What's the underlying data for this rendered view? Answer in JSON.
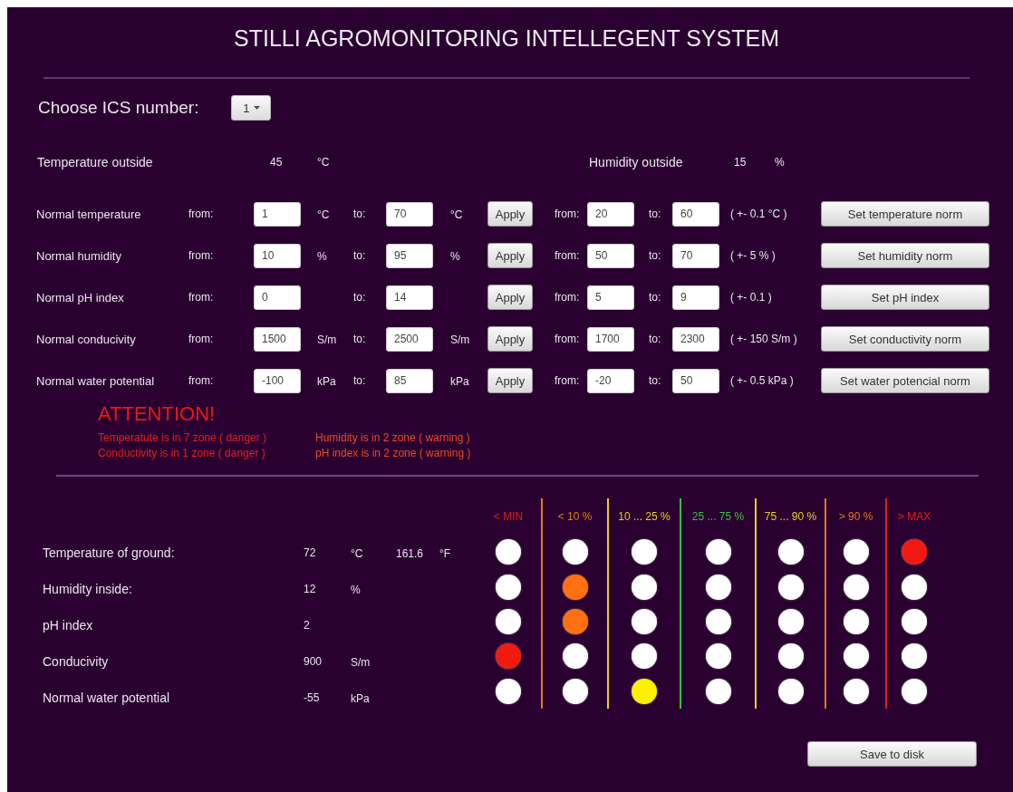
{
  "title": "STILLI AGROMONITORING INTELLEGENT SYSTEM",
  "ics": {
    "label": "Choose ICS number:",
    "value": "1"
  },
  "outside": [
    {
      "label": "Temperature outside",
      "value": "45",
      "unit": "°C"
    },
    {
      "label": "Humidity outside",
      "value": "15",
      "unit": "%"
    }
  ],
  "norms": [
    {
      "label": "Normal temperature",
      "from_label": "from:",
      "from": "1",
      "from_unit": "°C",
      "to_label": "to:",
      "to": "70",
      "to_unit": "°C",
      "apply": "Apply",
      "from2_label": "from:",
      "from2": "20",
      "to2_label": "to:",
      "to2": "60",
      "tolerance": "( +- 0.1 °C )",
      "set_button": "Set temperature norm"
    },
    {
      "label": "Normal humidity",
      "from_label": "from:",
      "from": "10",
      "from_unit": "%",
      "to_label": "to:",
      "to": "95",
      "to_unit": "%",
      "apply": "Apply",
      "from2_label": "from:",
      "from2": "50",
      "to2_label": "to:",
      "to2": "70",
      "tolerance": "( +- 5 % )",
      "set_button": "Set humidity norm"
    },
    {
      "label": "Normal pH index",
      "from_label": "from:",
      "from": "0",
      "to_label": "to:",
      "to": "14",
      "apply": "Apply",
      "from2_label": "from:",
      "from2": "5",
      "to2_label": "to:",
      "to2": "9",
      "tolerance": "( +- 0.1 )",
      "set_button": "Set pH index"
    },
    {
      "label": "Normal conducivity",
      "from_label": "from:",
      "from": "1500",
      "from_unit": "S/m",
      "to_label": "to:",
      "to": "2500",
      "to_unit": "S/m",
      "apply": "Apply",
      "from2_label": "from:",
      "from2": "1700",
      "to2_label": "to:",
      "to2": "2300",
      "tolerance": "( +- 150 S/m )",
      "set_button": "Set conductivity norm"
    },
    {
      "label": "Normal water potential",
      "from_label": "from:",
      "from": "-100",
      "from_unit": "kPa",
      "to_label": "to:",
      "to": "85",
      "to_unit": "kPa",
      "apply": "Apply",
      "from2_label": "from:",
      "from2": "-20",
      "to2_label": "to:",
      "to2": "50",
      "tolerance": "( +- 0.5 kPa  )",
      "set_button": "Set water potencial norm"
    }
  ],
  "attention": {
    "title": "ATTENTION!",
    "messages": [
      {
        "text": "Temperatute is in 7 zone ( danger )",
        "kind": "danger"
      },
      {
        "text": "Humidity is in 2 zone ( warning )",
        "kind": "warning"
      },
      {
        "text": "Conductivity is in 1 zone ( danger )",
        "kind": "danger"
      },
      {
        "text": "pH index is in 2 zone ( warning )",
        "kind": "warning"
      }
    ]
  },
  "zones": [
    {
      "label": "< MIN",
      "color": "#e0201c"
    },
    {
      "label": "< 10 %",
      "color": "#e07a1a"
    },
    {
      "label": "10 ... 25 %",
      "color": "#e8d020"
    },
    {
      "label": "25 ... 75 %",
      "color": "#3cc040"
    },
    {
      "label": "75 ... 90 %",
      "color": "#e8d020"
    },
    {
      "label": "> 90 %",
      "color": "#e07a1a"
    },
    {
      "label": "> MAX",
      "color": "#e0201c"
    }
  ],
  "readings": [
    {
      "label": "Temperature of ground:",
      "value": "72",
      "unit": "°C",
      "value2": "161.6",
      "unit2": "°F",
      "lamps": [
        {
          "on": false
        },
        {
          "on": false
        },
        {
          "on": false
        },
        {
          "on": false
        },
        {
          "on": false
        },
        {
          "on": false
        },
        {
          "on": true,
          "color": "#f01a10"
        }
      ]
    },
    {
      "label": "Humidity inside:",
      "value": "12",
      "unit": "%",
      "lamps": [
        {
          "on": false
        },
        {
          "on": true,
          "color": "#ff7010"
        },
        {
          "on": false
        },
        {
          "on": false
        },
        {
          "on": false
        },
        {
          "on": false
        },
        {
          "on": false
        }
      ]
    },
    {
      "label": "pH index",
      "value": "2",
      "lamps": [
        {
          "on": false
        },
        {
          "on": true,
          "color": "#ff7010"
        },
        {
          "on": false
        },
        {
          "on": false
        },
        {
          "on": false
        },
        {
          "on": false
        },
        {
          "on": false
        }
      ]
    },
    {
      "label": "Conducivity",
      "value": "900",
      "unit": "S/m",
      "lamps": [
        {
          "on": true,
          "color": "#f01a10"
        },
        {
          "on": false
        },
        {
          "on": false
        },
        {
          "on": false
        },
        {
          "on": false
        },
        {
          "on": false
        },
        {
          "on": false
        }
      ]
    },
    {
      "label": "Normal water potential",
      "value": "-55",
      "unit": "kPa",
      "lamps": [
        {
          "on": false
        },
        {
          "on": false
        },
        {
          "on": true,
          "color": "#fff000"
        },
        {
          "on": false
        },
        {
          "on": false
        },
        {
          "on": false
        },
        {
          "on": false
        }
      ]
    }
  ],
  "save_button": "Save to disk"
}
